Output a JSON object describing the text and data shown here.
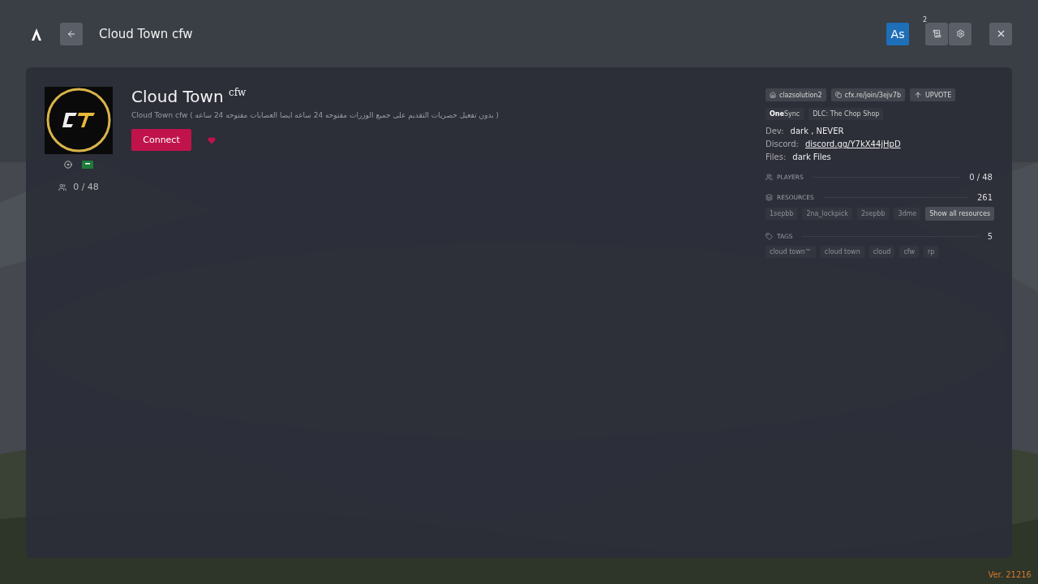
{
  "header": {
    "title": "Cloud Town cfw",
    "avatar": "As",
    "notification_count": "2"
  },
  "server": {
    "name": "Cloud Town $^{cfw}$",
    "description": "Cloud Town cfw ( بدون تفعيل حصريات التقديم على جميع الوزرات مفتوحه 24 ساعه ايضا العصابات مفتوحه 24 ساعه )",
    "connect": "Connect",
    "favorite": true,
    "players": "0 / 48"
  },
  "badges": [
    {
      "kind": "owner",
      "label": "clazsolution2"
    },
    {
      "kind": "link",
      "label": "cfx.re/join/3ejv7b"
    },
    {
      "kind": "upvote",
      "label": "UPVOTE"
    }
  ],
  "features": [
    "**One**Sync",
    "DLC: The Chop Shop"
  ],
  "info": [
    {
      "label": "Dev:",
      "value": "dark , NEVER",
      "kind": "text"
    },
    {
      "label": "Discord:",
      "value": "discord.gg/Y7kX44jHpD",
      "kind": "link"
    },
    {
      "label": "Files:",
      "value": "dark Files",
      "kind": "text"
    }
  ],
  "sections": [
    {
      "kind": "players",
      "title": "PLAYERS",
      "count": "0 / 48"
    },
    {
      "kind": "resources",
      "title": "RESOURCES",
      "count": "261",
      "items": [
        "1sepbb",
        "2na_lockpick",
        "2sepbb",
        "3dme"
      ],
      "action": "Show all resources"
    },
    {
      "kind": "tags",
      "title": "TAGS",
      "count": "5",
      "items": [
        "cloud town™",
        "cloud town",
        "cloud",
        "cfw",
        "rp"
      ]
    }
  ],
  "version": "Ver. 21216"
}
